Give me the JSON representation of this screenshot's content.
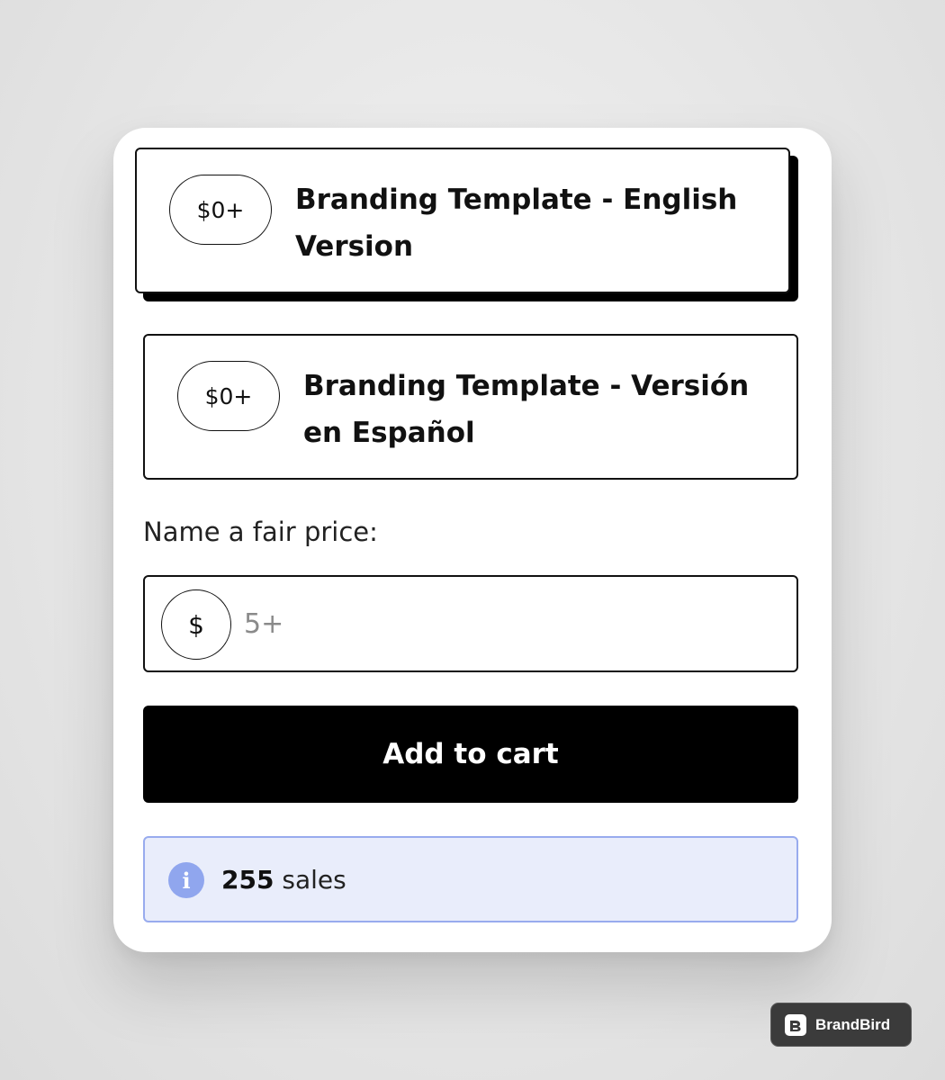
{
  "options": [
    {
      "price": "$0+",
      "title": "Branding Template - English Version",
      "selected": true
    },
    {
      "price": "$0+",
      "title": "Branding Template - Versión en Español",
      "selected": false
    }
  ],
  "price_form": {
    "label": "Name a fair price:",
    "currency_symbol": "$",
    "value": "",
    "placeholder": "5+"
  },
  "add_to_cart": {
    "label": "Add to cart"
  },
  "sales": {
    "count": "255",
    "suffix": "sales",
    "icon": "info-icon"
  },
  "watermark": {
    "name": "BrandBird",
    "icon": "brandbird-logo-icon"
  },
  "colors": {
    "button_bg": "#000000",
    "info_bg": "#e9edfb",
    "info_border": "#98abee",
    "info_icon": "#90a6ee"
  }
}
